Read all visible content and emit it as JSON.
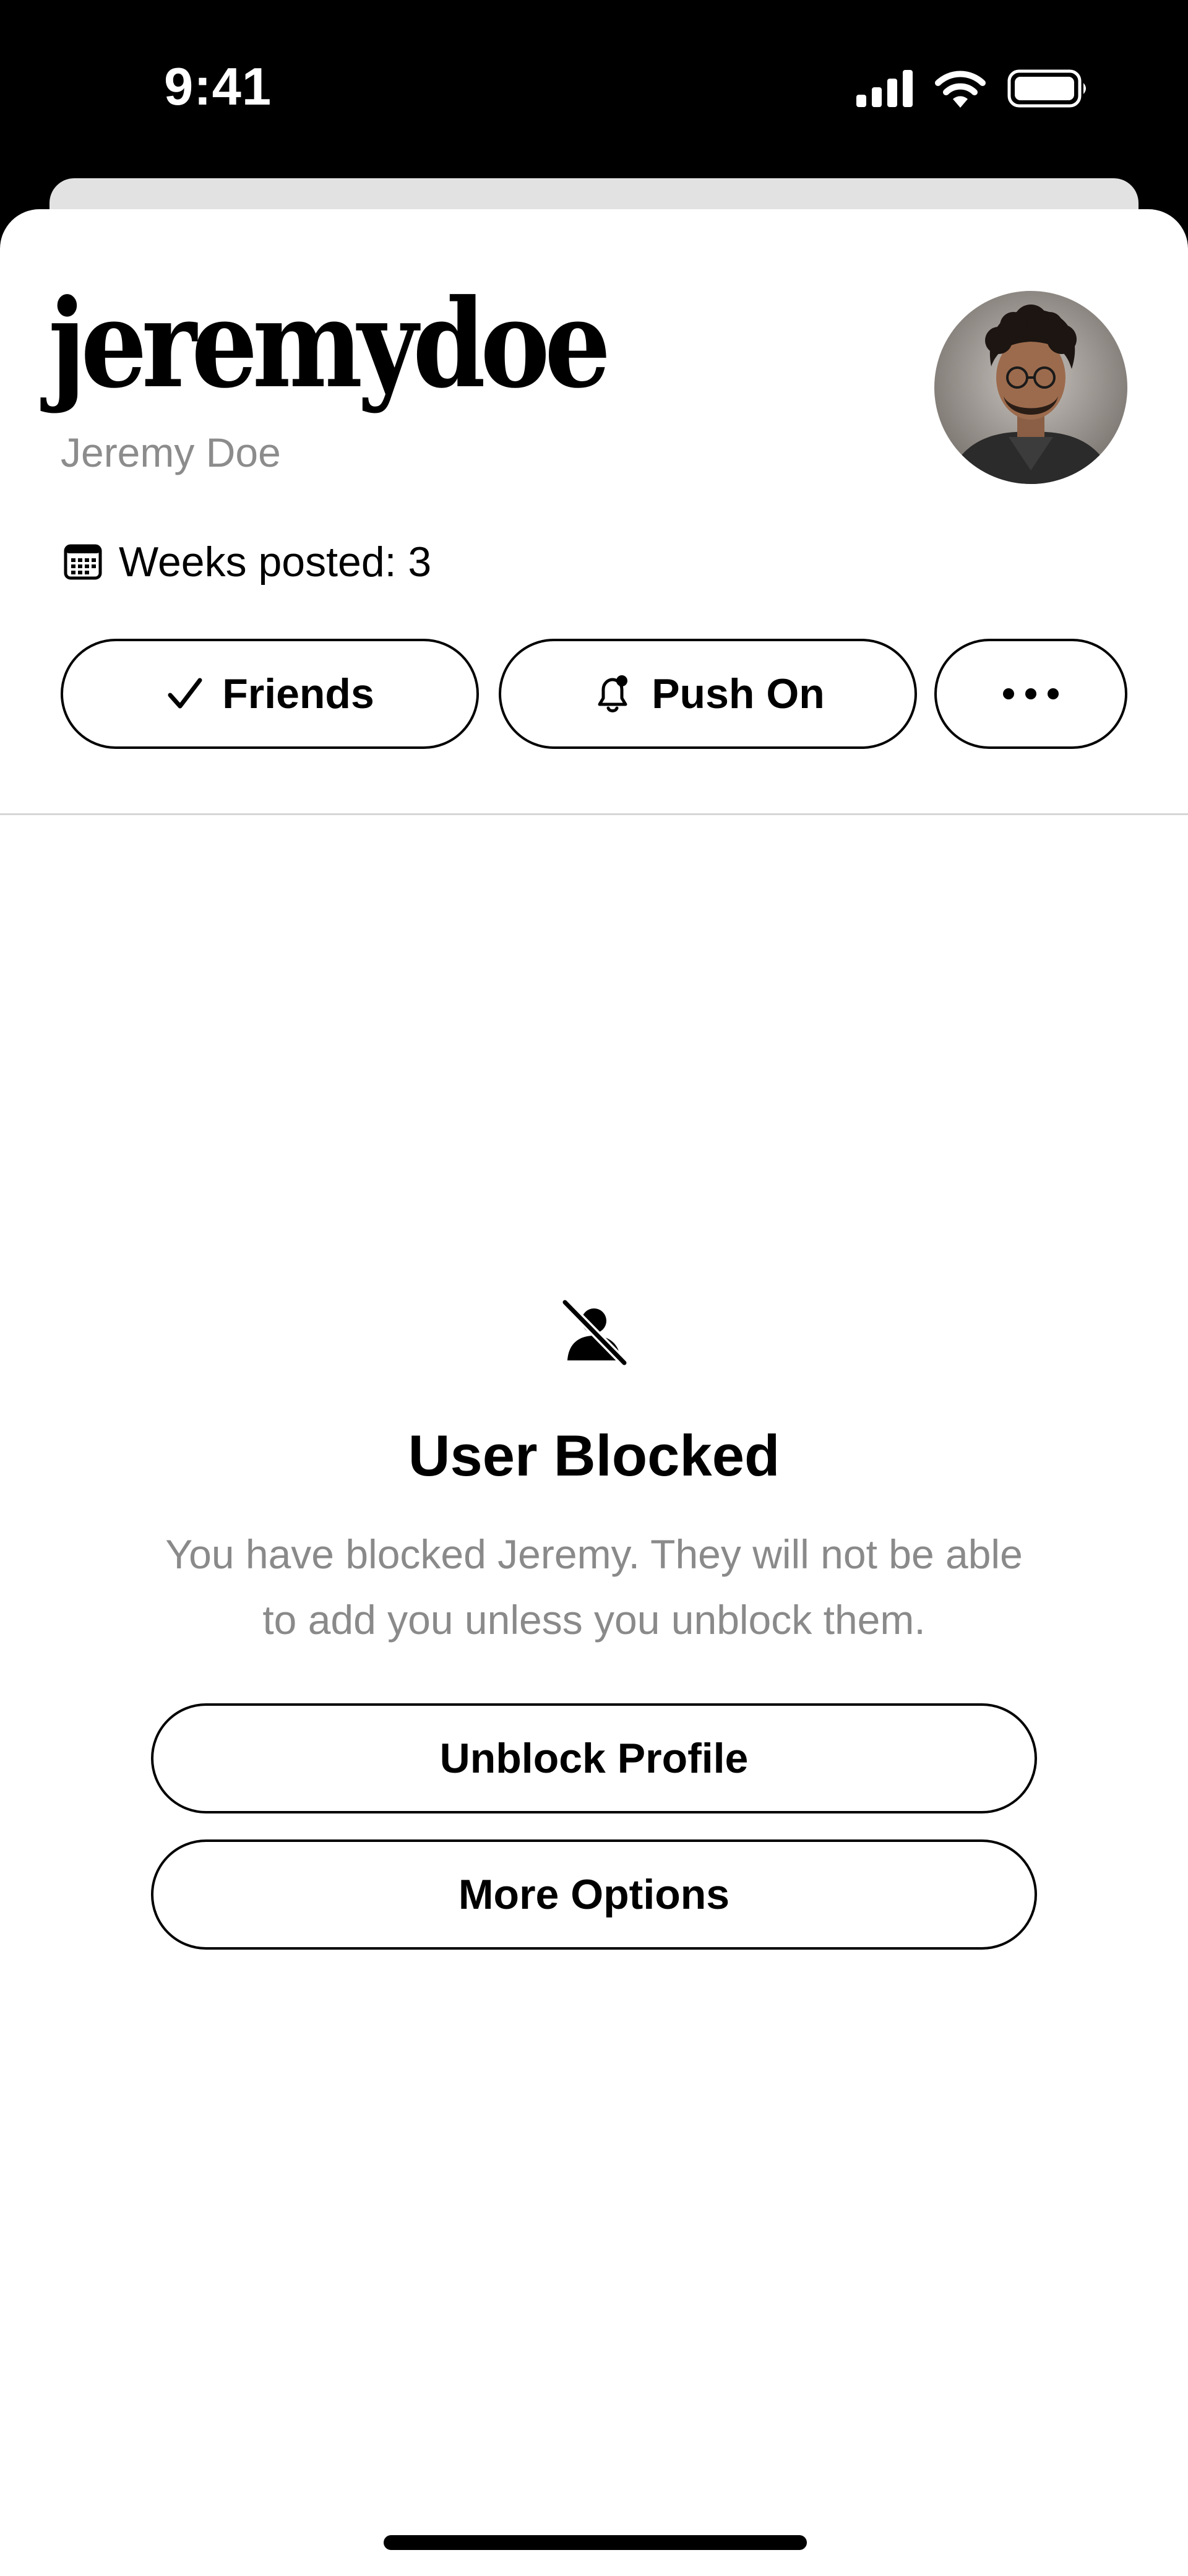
{
  "status_bar": {
    "time": "9:41",
    "icons": [
      "cellular-signal-icon",
      "wifi-icon",
      "battery-icon"
    ]
  },
  "profile": {
    "username": "jeremydoe",
    "display_name": "Jeremy Doe",
    "weeks_posted": "Weeks posted: 3",
    "weeks_icon": "calendar-icon"
  },
  "actions": {
    "friends_label": "Friends",
    "friends_icon": "checkmark-icon",
    "push_label": "Push On",
    "push_icon": "bell-icon",
    "more_icon": "ellipsis-icon"
  },
  "blocked": {
    "icon": "user-blocked-icon",
    "title": "User Blocked",
    "message": "You have blocked Jeremy. They will not be able to add you unless you unblock them.",
    "unblock_label": "Unblock Profile",
    "more_options_label": "More Options"
  },
  "colors": {
    "background": "#ffffff",
    "status_bar": "#000000",
    "secondary_text": "#8a8a8a",
    "border": "#000000"
  }
}
